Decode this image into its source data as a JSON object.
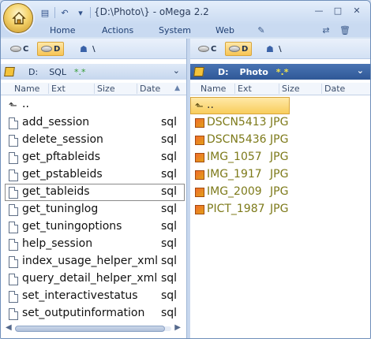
{
  "title": {
    "path": "{D:\\Photo\\}",
    "separator": " - ",
    "app_name": "oMega 2.2"
  },
  "ribbon": {
    "tabs": [
      {
        "label": "Home"
      },
      {
        "label": "Actions"
      },
      {
        "label": "System"
      },
      {
        "label": "Web"
      }
    ]
  },
  "left_pane": {
    "drives": [
      {
        "label": "C"
      },
      {
        "label": "D"
      },
      {
        "label": "\\"
      }
    ],
    "path": {
      "drive": "D:",
      "folder": "SQL",
      "mask": "*.*"
    },
    "columns": [
      "Name",
      "Ext",
      "Size",
      "Date"
    ],
    "updir": "..",
    "files": [
      {
        "name": "add_session",
        "ext": "sql"
      },
      {
        "name": "delete_session",
        "ext": "sql"
      },
      {
        "name": "get_pftableids",
        "ext": "sql"
      },
      {
        "name": "get_pstableids",
        "ext": "sql"
      },
      {
        "name": "get_tableids",
        "ext": "sql"
      },
      {
        "name": "get_tuninglog",
        "ext": "sql"
      },
      {
        "name": "get_tuningoptions",
        "ext": "sql"
      },
      {
        "name": "help_session",
        "ext": "sql"
      },
      {
        "name": "index_usage_helper_xml",
        "ext": "sql"
      },
      {
        "name": "query_detail_helper_xml",
        "ext": "sql"
      },
      {
        "name": "set_interactivestatus",
        "ext": "sql"
      },
      {
        "name": "set_outputinformation",
        "ext": "sql"
      }
    ]
  },
  "right_pane": {
    "drives": [
      {
        "label": "C"
      },
      {
        "label": "D"
      },
      {
        "label": "\\"
      }
    ],
    "path": {
      "drive": "D:",
      "folder": "Photo",
      "mask": "*.*"
    },
    "columns": [
      "Name",
      "Ext",
      "Size",
      "Date"
    ],
    "updir": "..",
    "files": [
      {
        "name": "DSCN5413",
        "ext": "JPG"
      },
      {
        "name": "DSCN5436",
        "ext": "JPG"
      },
      {
        "name": "IMG_1057",
        "ext": "JPG"
      },
      {
        "name": "IMG_1917",
        "ext": "JPG"
      },
      {
        "name": "IMG_2009",
        "ext": "JPG"
      },
      {
        "name": "PICT_1987",
        "ext": "JPG"
      }
    ]
  },
  "colors": {
    "accent": "#f7c454",
    "active_path_bar": "#2f5897",
    "image_file_text": "#7d7a1a"
  }
}
